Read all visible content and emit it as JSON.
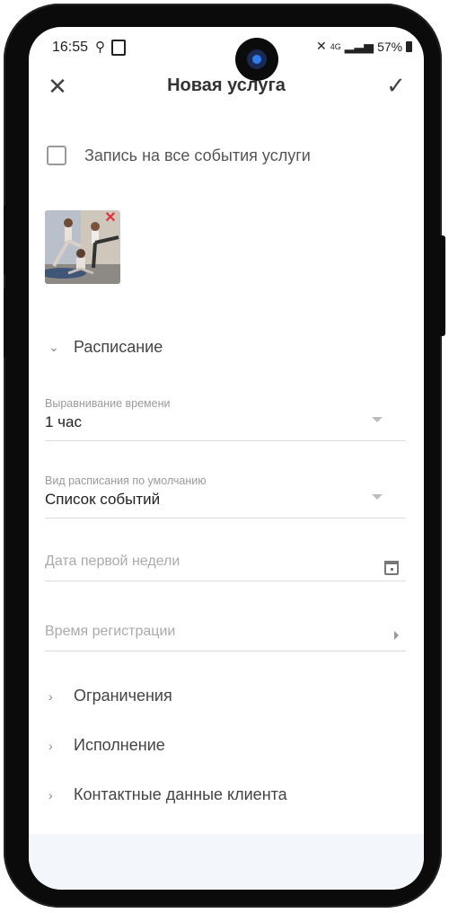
{
  "status": {
    "time": "16:55",
    "battery": "57%",
    "network": "4G"
  },
  "appbar": {
    "title": "Новая услуга",
    "close_icon": "close-icon",
    "confirm_icon": "check-icon"
  },
  "checkbox": {
    "label": "Запись на все события услуги",
    "checked": false
  },
  "schedule": {
    "label": "Расписание",
    "expanded": true
  },
  "fields": {
    "time_alignment": {
      "label": "Выравнивание времени",
      "value": "1 час"
    },
    "default_view": {
      "label": "Вид расписания по умолчанию",
      "value": "Список событий"
    },
    "first_week_date": {
      "placeholder": "Дата первой недели"
    },
    "registration_time": {
      "placeholder": "Время регистрации"
    }
  },
  "sections": {
    "restrictions": "Ограничения",
    "execution": "Исполнение",
    "client_contacts": "Контактные данные клиента"
  },
  "colors": {
    "accent_remove": "#e0323d",
    "text": "#222222",
    "muted": "#9a9a9a"
  }
}
